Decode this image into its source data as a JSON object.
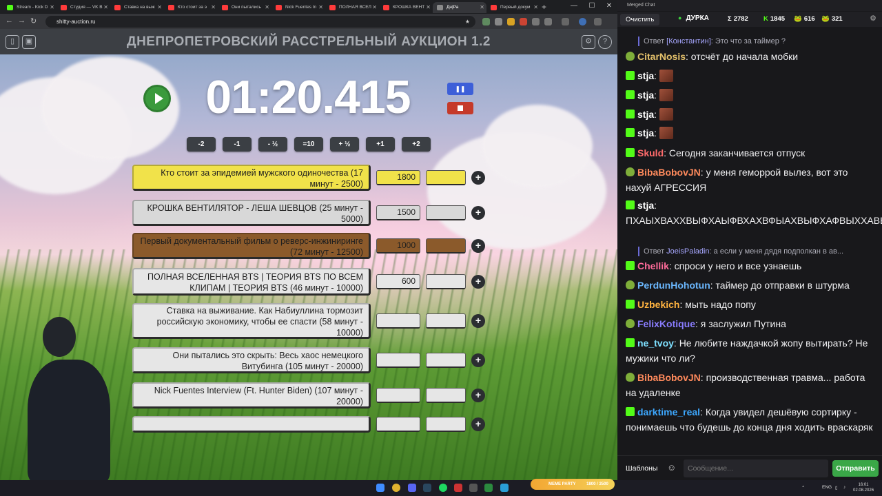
{
  "browser": {
    "tabs": [
      {
        "title": "Stream - Kick D",
        "color": "#53fc18"
      },
      {
        "title": "Студия — VK В",
        "color": "#ff3b3b"
      },
      {
        "title": "Ставка на выж",
        "color": "#ff3b3b"
      },
      {
        "title": "Кто стоит за э",
        "color": "#ff3b3b"
      },
      {
        "title": "Они пытались",
        "color": "#ff3b3b"
      },
      {
        "title": "Nick Fuentes In",
        "color": "#ff3b3b"
      },
      {
        "title": "ПОЛНАЯ ВСЕЛ",
        "color": "#ff3b3b"
      },
      {
        "title": "КРОШКА ВЕНТ",
        "color": "#ff3b3b"
      },
      {
        "title": "Дн|Ра",
        "color": "#8a8a8a"
      },
      {
        "title": "Первый докум",
        "color": "#ff3b3b"
      }
    ],
    "new_tab": "+",
    "address": "shitty-auction.ru"
  },
  "auction": {
    "title": "ДНЕПРОПЕТРОВСКИЙ РАССТРЕЛЬНЫЙ АУКЦИОН 1.2",
    "timer": "01:20.415",
    "pause_label": "❚❚",
    "steps": [
      "-2",
      "-1",
      "- ½",
      "=10",
      "+ ½",
      "+1",
      "+2"
    ],
    "lots": [
      {
        "name": "Кто стоит за эпидемией мужского одиночества (17 минут - 2500)",
        "amount": "1800",
        "color": "#f1e24a",
        "extra_color": "#f1e24a"
      },
      {
        "name": "КРОШКА ВЕНТИЛЯТОР - ЛЕША ШЕВЦОВ (25 минут - 5000)",
        "amount": "1500",
        "color": "#d8d8d8",
        "extra_color": "#d8d8d8"
      },
      {
        "name": "Первый документальный фильм о реверс-инжиниринге (72 минут - 12500)",
        "amount": "1000",
        "color": "#8b5a2b",
        "extra_color": "#8b5a2b"
      },
      {
        "name": "ПОЛНАЯ ВСЕЛЕННАЯ BTS | ТЕОРИЯ BTS ПО ВСЕМ КЛИПАМ | ТЕОРИЯ BTS (46 минут - 10000)",
        "amount": "600",
        "color": "#e6e6e6",
        "extra_color": "#e6e6e6"
      },
      {
        "name": "Ставка на выживание. Как Набиуллина тормозит российскую экономику, чтобы ее спасти (58 минут - 10000)",
        "amount": "",
        "color": "#e6e6e6",
        "extra_color": "#e6e6e6"
      },
      {
        "name": "Они пытались это скрыть: Весь хаос немецкого Витубинга (105 минут - 20000)",
        "amount": "",
        "color": "#e6e6e6",
        "extra_color": "#e6e6e6"
      },
      {
        "name": "Nick Fuentes Interview (Ft. Hunter Biden) (107 минут - 20000)",
        "amount": "",
        "color": "#e6e6e6",
        "extra_color": "#e6e6e6"
      },
      {
        "name": "",
        "amount": "",
        "color": "#e6e6e6",
        "extra_color": "#e6e6e6"
      }
    ],
    "plus_label": "+"
  },
  "chat": {
    "window_title": "Merged Chat",
    "clear_label": "Очистить",
    "nick": "ДУРКА",
    "stats": [
      {
        "icon": "Σ",
        "value": "2782"
      },
      {
        "icon": "K",
        "value": "1845"
      },
      {
        "icon": "🐸",
        "value": "616"
      },
      {
        "icon": "🐸",
        "value": "321"
      }
    ],
    "top_reply": {
      "prefix": "Ответ",
      "user": "[Константин]",
      "text": ": Это что за таймер ?"
    },
    "messages": [
      {
        "badge": "frog",
        "user": "CitarNosis",
        "color": "#e3c06b",
        "text": ": отсчёт до начала мобки"
      },
      {
        "badge": "kick",
        "user": "stja",
        "color": "#ffffff",
        "text": ":"
      },
      {
        "badge": "kick",
        "user": "stja",
        "color": "#ffffff",
        "text": ":"
      },
      {
        "badge": "kick",
        "user": "stja",
        "color": "#ffffff",
        "text": ":"
      },
      {
        "badge": "kick",
        "user": "stja",
        "color": "#ffffff",
        "text": ":"
      },
      {
        "badge": "kick",
        "user": "Skuld",
        "color": "#ff6b6b",
        "text": ": Сегодня заканчивается отпуск"
      },
      {
        "badge": "frog",
        "user": "BibaBobovJN",
        "color": "#ff8a5c",
        "text": ": у меня геморрой вылез, вот это нахуй АГРЕССИЯ"
      },
      {
        "badge": "kick",
        "user": "stja",
        "color": "#ffffff",
        "text": ": ПХАЫХВАХХВЫФХАЫФВХАХВФЫАХВЫФХАФВЫХХАВЫФХ"
      },
      {
        "badge": "kick",
        "user": "Chellik",
        "color": "#ff6b9a",
        "text": ": спроси у него и все узнаешь"
      },
      {
        "badge": "frog",
        "user": "PerdunHohotun",
        "color": "#6bb8ff",
        "text": ": таймер до отправки в штурма"
      },
      {
        "badge": "kick",
        "user": "Uzbekich",
        "color": "#ffb340",
        "text": ": мыть надо попу"
      },
      {
        "badge": "frog",
        "user": "FelixKotique",
        "color": "#8a7dff",
        "text": ": я заслужил Путина"
      },
      {
        "badge": "kick",
        "user": "ne_tvoy",
        "color": "#7ee0ff",
        "text": ": Не любите наждачкой жопу вытирать? Не мужики что ли?"
      },
      {
        "badge": "frog",
        "user": "BibaBobovJN",
        "color": "#ff8a5c",
        "text": ": производственная травма... работа на удаленке"
      },
      {
        "badge": "kick",
        "user": "darktime_real",
        "color": "#3da8ff",
        "text": ": Когда увидел дешёвую сортирку - понимаешь что будешь до конца дня ходить враскаряк"
      }
    ],
    "inline_reply": {
      "prefix": "Ответ",
      "user": "JoeisPaladin",
      "text": ": а если у меня дядя подполкан в ав..."
    },
    "templates_label": "Шаблоны",
    "input_placeholder": "Сообщение...",
    "send_label": "Отправить"
  },
  "taskbar": {
    "game_label": "MEME PARTY",
    "game_progress": "1800 / 2500",
    "lang": "ENG",
    "time": "16:01",
    "date": "02.08.2026"
  }
}
